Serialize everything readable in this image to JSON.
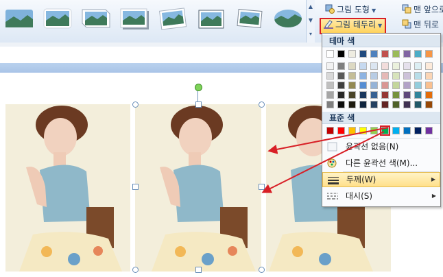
{
  "ribbon": {
    "picture_shape_label": "그림 도형",
    "picture_border_label": "그림 테두리",
    "bring_forward_label": "맨 앞으로",
    "send_backward_label": "맨 뒤로",
    "gallery_styles": [
      "rounded-rect",
      "soft-edge",
      "bevel",
      "shadow",
      "tilted-white-frame",
      "double-frame",
      "rotated-frame",
      "oval"
    ]
  },
  "border_menu": {
    "theme_colors_header": "테마 색",
    "standard_colors_header": "표준 색",
    "theme_top_row": [
      "#ffffff",
      "#000000",
      "#eeece1",
      "#1f497d",
      "#4f81bd",
      "#c0504d",
      "#9bbb59",
      "#8064a2",
      "#4bacc6",
      "#f79646"
    ],
    "theme_shades": [
      [
        "#f2f2f2",
        "#7f7f7f",
        "#ddd9c3",
        "#c6d9f0",
        "#dbe5f1",
        "#f2dcdb",
        "#ebf1dd",
        "#e5e0ec",
        "#dbeef3",
        "#fdeada"
      ],
      [
        "#d8d8d8",
        "#595959",
        "#c4bd97",
        "#8db3e2",
        "#b8cce4",
        "#e5b9b7",
        "#d7e3bc",
        "#ccc1d9",
        "#b7dde8",
        "#fbd5b5"
      ],
      [
        "#bfbfbf",
        "#3f3f3f",
        "#938953",
        "#548dd4",
        "#95b3d7",
        "#d99694",
        "#c3d69b",
        "#b2a2c7",
        "#92cddc",
        "#fac08f"
      ],
      [
        "#a5a5a5",
        "#262626",
        "#494429",
        "#17365d",
        "#366092",
        "#953734",
        "#76923c",
        "#5f497a",
        "#31859b",
        "#e36c09"
      ],
      [
        "#7f7f7f",
        "#0c0c0c",
        "#1d1b10",
        "#0f243e",
        "#244061",
        "#632423",
        "#4f6128",
        "#3f3151",
        "#205867",
        "#974806"
      ]
    ],
    "standard_colors": [
      "#c00000",
      "#ff0000",
      "#ffc000",
      "#ffff00",
      "#92d050",
      "#00b050",
      "#00b0f0",
      "#0070c0",
      "#002060",
      "#7030a0"
    ],
    "selected_standard_color": "#00b050",
    "no_outline_label": "윤곽선 없음(N)",
    "more_colors_label": "다른 윤곽선 색(M)...",
    "weight_label": "두께(W)",
    "dashes_label": "대시(S)"
  },
  "document": {
    "photo_frames": [
      "#8c6fb8",
      "#3f8c84",
      "#d8566b"
    ],
    "annotation_arrow_color": "#d81f26"
  }
}
